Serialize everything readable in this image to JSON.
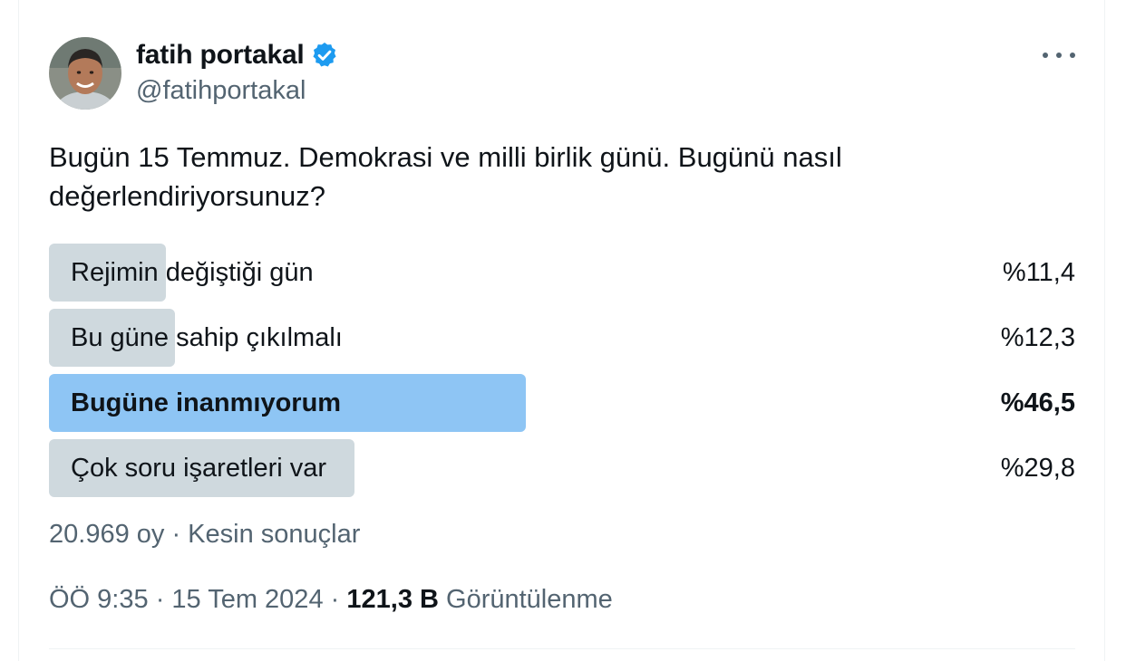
{
  "author": {
    "display_name": "fatih portakal",
    "handle": "@fatihportakal",
    "verified_icon": "verified-badge-icon",
    "avatar": "profile-photo"
  },
  "more_menu_icon": "more-horizontal-icon",
  "tweet": {
    "text": "Bugün 15 Temmuz. Demokrasi ve milli birlik günü. Bugünü nasıl değerlendiriyorsunuz?"
  },
  "poll": {
    "options": [
      {
        "label": "Rejimin değiştiği gün",
        "percent_text": "%11,4",
        "percent": 11.4,
        "winner": false
      },
      {
        "label": "Bu güne sahip çıkılmalı",
        "percent_text": "%12,3",
        "percent": 12.3,
        "winner": false
      },
      {
        "label": "Bugüne inanmıyorum",
        "percent_text": "%46,5",
        "percent": 46.5,
        "winner": true
      },
      {
        "label": "Çok soru işaretleri var",
        "percent_text": "%29,8",
        "percent": 29.8,
        "winner": false
      }
    ],
    "footer": "20.969 oy · Kesin sonuçlar"
  },
  "meta": {
    "time": "ÖÖ 9:35",
    "separator": "·",
    "date": "15 Tem 2024",
    "views_count": "121,3 B",
    "views_label": "Görüntülenme"
  },
  "colors": {
    "bar": "#cfd9de",
    "winner_bar": "#8ec5f4",
    "verified": "#1d9bf0",
    "secondary_text": "#536471"
  }
}
